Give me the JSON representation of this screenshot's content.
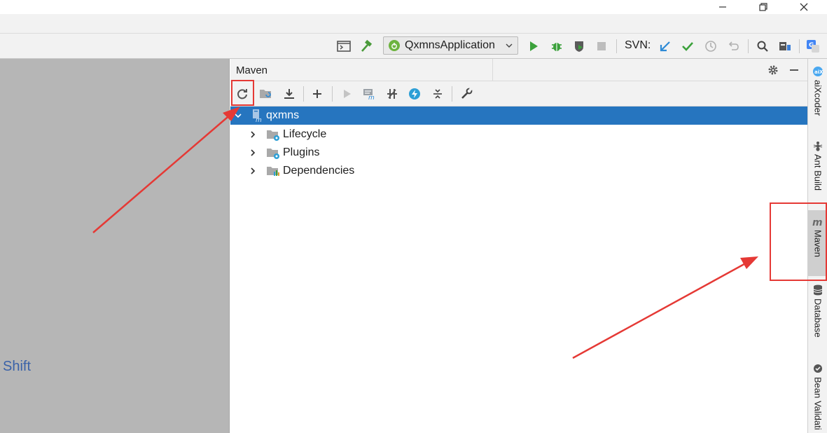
{
  "window": {
    "minimize_icon": "minimize-icon",
    "restore_icon": "restore-icon",
    "close_icon": "close-icon"
  },
  "toolbar": {
    "run_configuration": "QxmnsApplication",
    "svn_label": "SVN:"
  },
  "editor": {
    "hint_text": "Shift"
  },
  "maven_panel": {
    "title": "Maven",
    "tree": [
      {
        "label": "qxmns",
        "selected": true,
        "expanded": true,
        "icon": "maven-module-icon"
      },
      {
        "label": "Lifecycle",
        "expanded": false,
        "icon": "lifecycle-folder-icon"
      },
      {
        "label": "Plugins",
        "expanded": false,
        "icon": "plugins-folder-icon"
      },
      {
        "label": "Dependencies",
        "expanded": false,
        "icon": "dependencies-folder-icon"
      }
    ]
  },
  "right_stripe": {
    "tabs": [
      {
        "label": "aiXcoder",
        "active": false
      },
      {
        "label": "Ant Build",
        "active": false
      },
      {
        "label": "Maven",
        "active": true
      },
      {
        "label": "Database",
        "active": false
      },
      {
        "label": "Bean Validati",
        "active": false
      }
    ]
  },
  "colors": {
    "selection": "#2675bf",
    "annotation": "#e53935",
    "panel_bg": "#f2f2f2",
    "editor_bg": "#b6b6b6"
  }
}
